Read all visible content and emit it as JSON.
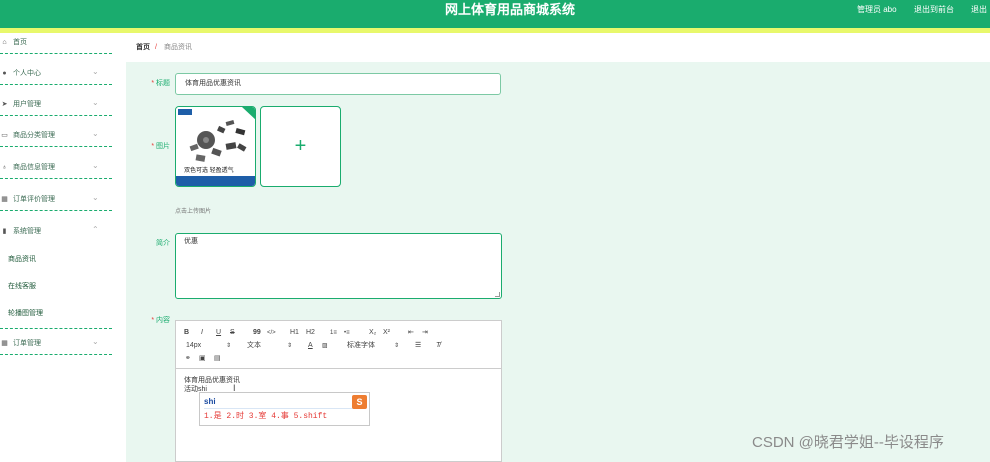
{
  "header": {
    "title": "网上体育用品商城系统",
    "admin_label": "管理员 abo",
    "front_link": "退出到前台",
    "logout_link": "退出"
  },
  "sidebar": {
    "items": [
      {
        "label": "首页",
        "icon": "home-icon"
      },
      {
        "label": "个人中心",
        "icon": "user-icon"
      },
      {
        "label": "用户管理",
        "icon": "send-icon"
      },
      {
        "label": "商品分类管理",
        "icon": "folder-icon"
      },
      {
        "label": "商品信息管理",
        "icon": "mic-icon"
      },
      {
        "label": "订单评价管理",
        "icon": "grid-icon"
      },
      {
        "label": "系统管理",
        "icon": "chart-icon"
      },
      {
        "label": "订单管理",
        "icon": "grid-icon"
      }
    ],
    "submenu": [
      "商品资讯",
      "在线客服",
      "轮播图管理"
    ]
  },
  "breadcrumb": {
    "home": "首页",
    "sep": "/",
    "current": "商品资讯"
  },
  "form": {
    "title_label": "标题",
    "title_value": "体育用品优惠资讯",
    "image_label": "图片",
    "image_caption": "双色可选 轻盈透气",
    "upload_hint": "点击上传图片",
    "intro_label": "简介",
    "intro_value": "优惠",
    "content_label": "内容"
  },
  "editor": {
    "toolbar_row1": [
      "B",
      "I",
      "U",
      "S",
      "99",
      "</>",
      "H1",
      "H2",
      "1≡",
      "•≡",
      "X₂",
      "X²",
      "⇤",
      "⇥"
    ],
    "font_size": "14px",
    "text_style": "文本",
    "font_family": "标准字体",
    "content_line1": "体育用品优惠资讯",
    "content_line2": "活动shi"
  },
  "ime": {
    "composition": "shi",
    "candidates": "1.是  2.时  3.室  4.事  5.shift",
    "logo": "S"
  },
  "watermark": "CSDN @晓君学姐--毕设程序"
}
